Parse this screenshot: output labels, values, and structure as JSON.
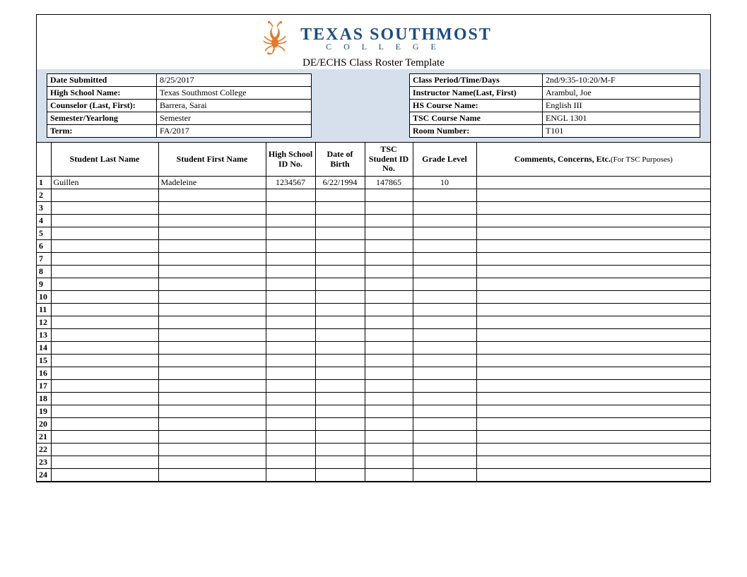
{
  "header": {
    "college_name": "TEXAS SOUTHMOST",
    "college_sub": "C O L L E G E",
    "template_title": "DE/ECHS Class Roster Template"
  },
  "info_left": [
    {
      "label": "Date Submitted",
      "value": "8/25/2017"
    },
    {
      "label": "High School Name:",
      "value": "Texas Southmost College"
    },
    {
      "label": "Counselor (Last, First):",
      "value": "Barrera, Sarai"
    },
    {
      "label": "Semester/Yearlong",
      "value": "Semester"
    },
    {
      "label": "Term:",
      "value": "FA/2017"
    }
  ],
  "info_right": [
    {
      "label": "Class Period/Time/Days",
      "value": "2nd/9:35-10:20/M-F"
    },
    {
      "label": "Instructor Name(Last, First)",
      "value": "Arambul, Joe"
    },
    {
      "label": "HS Course Name:",
      "value": "English III"
    },
    {
      "label": "TSC Course Name",
      "value": "ENGL 1301"
    },
    {
      "label": "Room Number:",
      "value": "T101"
    }
  ],
  "columns": {
    "last": "Student Last Name",
    "first": "Student First Name",
    "hsid": "High School ID No.",
    "dob": "Date of Birth",
    "tscid": "TSC Student ID No.",
    "grade": "Grade Level",
    "comments": "Comments, Concerns, Etc.",
    "comments_note": "(For TSC Purposes)"
  },
  "rows": [
    {
      "n": "1",
      "last": "Guillen",
      "first": "Madeleine",
      "hsid": "1234567",
      "dob": "6/22/1994",
      "tscid": "147865",
      "grade": "10",
      "comments": ""
    },
    {
      "n": "2",
      "last": "",
      "first": "",
      "hsid": "",
      "dob": "",
      "tscid": "",
      "grade": "",
      "comments": ""
    },
    {
      "n": "3",
      "last": "",
      "first": "",
      "hsid": "",
      "dob": "",
      "tscid": "",
      "grade": "",
      "comments": ""
    },
    {
      "n": "4",
      "last": "",
      "first": "",
      "hsid": "",
      "dob": "",
      "tscid": "",
      "grade": "",
      "comments": ""
    },
    {
      "n": "5",
      "last": "",
      "first": "",
      "hsid": "",
      "dob": "",
      "tscid": "",
      "grade": "",
      "comments": ""
    },
    {
      "n": "6",
      "last": "",
      "first": "",
      "hsid": "",
      "dob": "",
      "tscid": "",
      "grade": "",
      "comments": ""
    },
    {
      "n": "7",
      "last": "",
      "first": "",
      "hsid": "",
      "dob": "",
      "tscid": "",
      "grade": "",
      "comments": ""
    },
    {
      "n": "8",
      "last": "",
      "first": "",
      "hsid": "",
      "dob": "",
      "tscid": "",
      "grade": "",
      "comments": ""
    },
    {
      "n": "9",
      "last": "",
      "first": "",
      "hsid": "",
      "dob": "",
      "tscid": "",
      "grade": "",
      "comments": ""
    },
    {
      "n": "10",
      "last": "",
      "first": "",
      "hsid": "",
      "dob": "",
      "tscid": "",
      "grade": "",
      "comments": ""
    },
    {
      "n": "11",
      "last": "",
      "first": "",
      "hsid": "",
      "dob": "",
      "tscid": "",
      "grade": "",
      "comments": ""
    },
    {
      "n": "12",
      "last": "",
      "first": "",
      "hsid": "",
      "dob": "",
      "tscid": "",
      "grade": "",
      "comments": ""
    },
    {
      "n": "13",
      "last": "",
      "first": "",
      "hsid": "",
      "dob": "",
      "tscid": "",
      "grade": "",
      "comments": ""
    },
    {
      "n": "14",
      "last": "",
      "first": "",
      "hsid": "",
      "dob": "",
      "tscid": "",
      "grade": "",
      "comments": ""
    },
    {
      "n": "15",
      "last": "",
      "first": "",
      "hsid": "",
      "dob": "",
      "tscid": "",
      "grade": "",
      "comments": ""
    },
    {
      "n": "16",
      "last": "",
      "first": "",
      "hsid": "",
      "dob": "",
      "tscid": "",
      "grade": "",
      "comments": ""
    },
    {
      "n": "17",
      "last": "",
      "first": "",
      "hsid": "",
      "dob": "",
      "tscid": "",
      "grade": "",
      "comments": ""
    },
    {
      "n": "18",
      "last": "",
      "first": "",
      "hsid": "",
      "dob": "",
      "tscid": "",
      "grade": "",
      "comments": ""
    },
    {
      "n": "19",
      "last": "",
      "first": "",
      "hsid": "",
      "dob": "",
      "tscid": "",
      "grade": "",
      "comments": ""
    },
    {
      "n": "20",
      "last": "",
      "first": "",
      "hsid": "",
      "dob": "",
      "tscid": "",
      "grade": "",
      "comments": ""
    },
    {
      "n": "21",
      "last": "",
      "first": "",
      "hsid": "",
      "dob": "",
      "tscid": "",
      "grade": "",
      "comments": ""
    },
    {
      "n": "22",
      "last": "",
      "first": "",
      "hsid": "",
      "dob": "",
      "tscid": "",
      "grade": "",
      "comments": ""
    },
    {
      "n": "23",
      "last": "",
      "first": "",
      "hsid": "",
      "dob": "",
      "tscid": "",
      "grade": "",
      "comments": ""
    },
    {
      "n": "24",
      "last": "",
      "first": "",
      "hsid": "",
      "dob": "",
      "tscid": "",
      "grade": "",
      "comments": ""
    }
  ]
}
